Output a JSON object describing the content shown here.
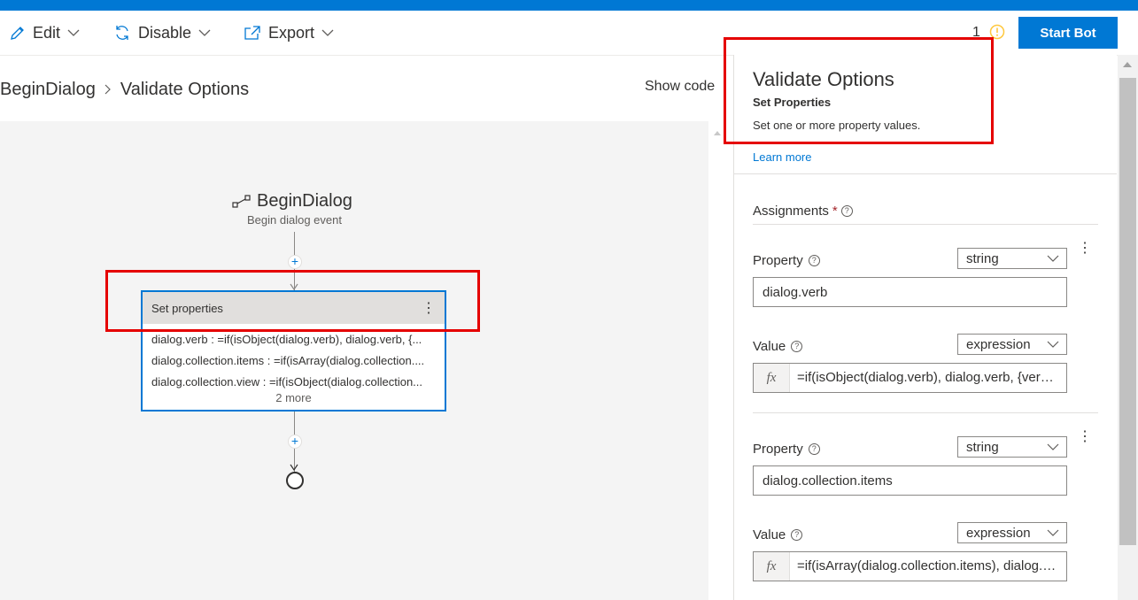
{
  "toolbar": {
    "edit_label": "Edit",
    "disable_label": "Disable",
    "export_label": "Export",
    "notification_count": "1",
    "start_bot_label": "Start Bot"
  },
  "breadcrumb": {
    "items": [
      "BeginDialog",
      "Validate Options"
    ]
  },
  "show_code_label": "Show code",
  "flow": {
    "trigger_title": "BeginDialog",
    "trigger_subtitle": "Begin dialog event",
    "action_card": {
      "header": "Set properties",
      "lines": [
        "dialog.verb : =if(isObject(dialog.verb), dialog.verb, {...",
        "dialog.collection.items : =if(isArray(dialog.collection....",
        "dialog.collection.view : =if(isObject(dialog.collection..."
      ],
      "more": "2 more"
    }
  },
  "panel": {
    "title": "Validate Options",
    "subtitle": "Set Properties",
    "description": "Set one or more property values.",
    "learn_more": "Learn more",
    "assignments_label": "Assignments",
    "required_mark": "*",
    "assignments": [
      {
        "property_label": "Property",
        "property_type": "string",
        "property_value": "dialog.verb",
        "value_label": "Value",
        "value_type": "expression",
        "value_expr": "=if(isObject(dialog.verb), dialog.verb, {verb: dialog.verb})"
      },
      {
        "property_label": "Property",
        "property_type": "string",
        "property_value": "dialog.collection.items",
        "value_label": "Value",
        "value_type": "expression",
        "value_expr": "=if(isArray(dialog.collection.items), dialog.collection.items, [])"
      }
    ]
  },
  "icons": {
    "fx": "fx",
    "help": "?",
    "kebab": "⋮",
    "plus": "+"
  },
  "colors": {
    "accent": "#0078d4",
    "highlight": "#e50000",
    "warning": "#ffc83d"
  }
}
